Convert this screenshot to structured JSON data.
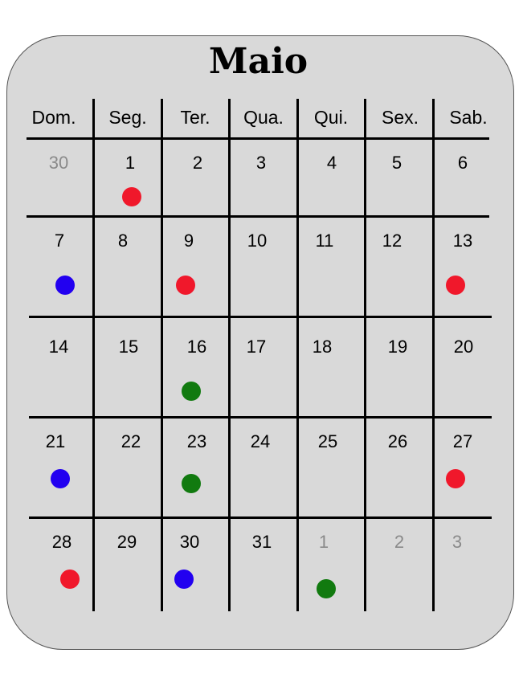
{
  "calendar": {
    "month": "Maio",
    "weekdays": [
      "Dom.",
      "Seg.",
      "Ter.",
      "Qua.",
      "Qui.",
      "Sex.",
      "Sab."
    ],
    "colors": {
      "red": "#f0182b",
      "blue": "#2200f0",
      "green": "#117a0f",
      "muted": "#8a8a8a"
    },
    "weeks": [
      [
        {
          "day": "30",
          "muted": true,
          "dot": null
        },
        {
          "day": "1",
          "muted": false,
          "dot": "red"
        },
        {
          "day": "2",
          "muted": false,
          "dot": null
        },
        {
          "day": "3",
          "muted": false,
          "dot": null
        },
        {
          "day": "4",
          "muted": false,
          "dot": null
        },
        {
          "day": "5",
          "muted": false,
          "dot": null
        },
        {
          "day": "6",
          "muted": false,
          "dot": null
        }
      ],
      [
        {
          "day": "7",
          "muted": false,
          "dot": "blue"
        },
        {
          "day": "8",
          "muted": false,
          "dot": null
        },
        {
          "day": "9",
          "muted": false,
          "dot": "red"
        },
        {
          "day": "10",
          "muted": false,
          "dot": null
        },
        {
          "day": "11",
          "muted": false,
          "dot": null
        },
        {
          "day": "12",
          "muted": false,
          "dot": null
        },
        {
          "day": "13",
          "muted": false,
          "dot": "red"
        }
      ],
      [
        {
          "day": "14",
          "muted": false,
          "dot": null
        },
        {
          "day": "15",
          "muted": false,
          "dot": null
        },
        {
          "day": "16",
          "muted": false,
          "dot": "green"
        },
        {
          "day": "17",
          "muted": false,
          "dot": null
        },
        {
          "day": "18",
          "muted": false,
          "dot": null
        },
        {
          "day": "19",
          "muted": false,
          "dot": null
        },
        {
          "day": "20",
          "muted": false,
          "dot": null
        }
      ],
      [
        {
          "day": "21",
          "muted": false,
          "dot": "blue"
        },
        {
          "day": "22",
          "muted": false,
          "dot": null
        },
        {
          "day": "23",
          "muted": false,
          "dot": "green"
        },
        {
          "day": "24",
          "muted": false,
          "dot": null
        },
        {
          "day": "25",
          "muted": false,
          "dot": null
        },
        {
          "day": "26",
          "muted": false,
          "dot": null
        },
        {
          "day": "27",
          "muted": false,
          "dot": "red"
        }
      ],
      [
        {
          "day": "28",
          "muted": false,
          "dot": "red"
        },
        {
          "day": "29",
          "muted": false,
          "dot": null
        },
        {
          "day": "30",
          "muted": false,
          "dot": "blue"
        },
        {
          "day": "31",
          "muted": false,
          "dot": null
        },
        {
          "day": "1",
          "muted": true,
          "dot": "green"
        },
        {
          "day": "2",
          "muted": true,
          "dot": null
        },
        {
          "day": "3",
          "muted": true,
          "dot": null
        }
      ]
    ]
  }
}
